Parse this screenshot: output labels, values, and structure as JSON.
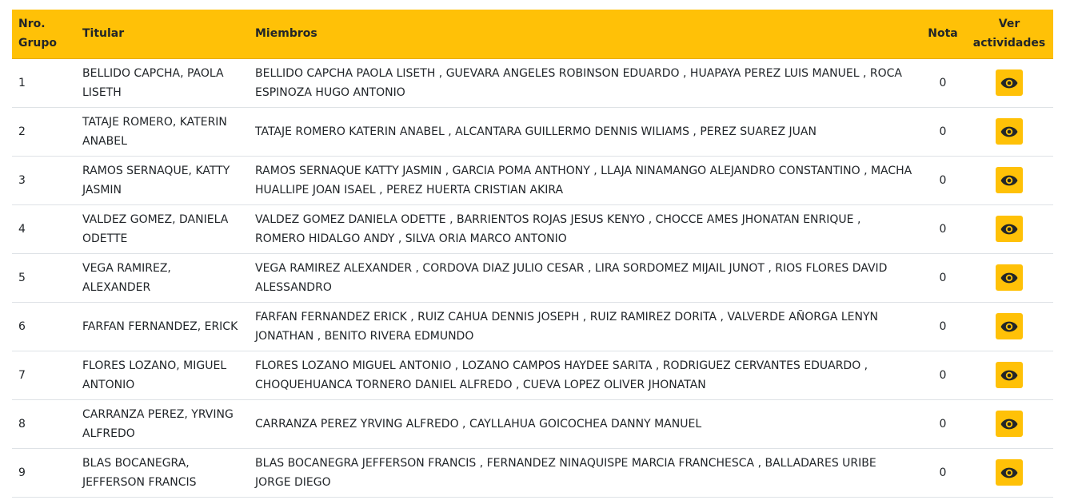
{
  "table": {
    "headers": {
      "nro": "Nro. Grupo",
      "titular": "Titular",
      "miembros": "Miembros",
      "nota": "Nota",
      "ver": "Ver actividades"
    },
    "rows": [
      {
        "nro": "1",
        "titular": "BELLIDO CAPCHA, PAOLA LISETH",
        "miembros": "BELLIDO CAPCHA PAOLA LISETH , GUEVARA ANGELES ROBINSON EDUARDO , HUAPAYA PEREZ LUIS MANUEL , ROCA ESPINOZA HUGO ANTONIO",
        "nota": "0"
      },
      {
        "nro": "2",
        "titular": "TATAJE ROMERO, KATERIN ANABEL",
        "miembros": "TATAJE ROMERO KATERIN ANABEL , ALCANTARA GUILLERMO DENNIS WILIAMS , PEREZ SUAREZ JUAN",
        "nota": "0"
      },
      {
        "nro": "3",
        "titular": "RAMOS SERNAQUE, KATTY JASMIN",
        "miembros": "RAMOS SERNAQUE KATTY JASMIN , GARCIA POMA ANTHONY , LLAJA NINAMANGO ALEJANDRO CONSTANTINO , MACHA HUALLIPE JOAN ISAEL , PEREZ HUERTA CRISTIAN AKIRA",
        "nota": "0"
      },
      {
        "nro": "4",
        "titular": "VALDEZ GOMEZ, DANIELA ODETTE",
        "miembros": "VALDEZ GOMEZ DANIELA ODETTE , BARRIENTOS ROJAS JESUS KENYO , CHOCCE AMES JHONATAN ENRIQUE , ROMERO HIDALGO ANDY , SILVA ORIA MARCO ANTONIO",
        "nota": "0"
      },
      {
        "nro": "5",
        "titular": "VEGA RAMIREZ, ALEXANDER",
        "miembros": "VEGA RAMIREZ ALEXANDER , CORDOVA DIAZ JULIO CESAR , LIRA SORDOMEZ MIJAIL JUNOT , RIOS FLORES DAVID ALESSANDRO",
        "nota": "0"
      },
      {
        "nro": "6",
        "titular": "FARFAN FERNANDEZ, ERICK",
        "miembros": "FARFAN FERNANDEZ ERICK , RUIZ CAHUA DENNIS JOSEPH , RUIZ RAMIREZ DORITA , VALVERDE AÑORGA LENYN JONATHAN , BENITO RIVERA EDMUNDO",
        "nota": "0"
      },
      {
        "nro": "7",
        "titular": "FLORES LOZANO, MIGUEL ANTONIO",
        "miembros": "FLORES LOZANO MIGUEL ANTONIO , LOZANO CAMPOS HAYDEE SARITA , RODRIGUEZ CERVANTES EDUARDO , CHOQUEHUANCA TORNERO DANIEL ALFREDO , CUEVA LOPEZ OLIVER JHONATAN",
        "nota": "0"
      },
      {
        "nro": "8",
        "titular": "CARRANZA PEREZ, YRVING ALFREDO",
        "miembros": "CARRANZA PEREZ YRVING ALFREDO , CAYLLAHUA GOICOCHEA DANNY MANUEL",
        "nota": "0"
      },
      {
        "nro": "9",
        "titular": "BLAS BOCANEGRA, JEFFERSON FRANCIS",
        "miembros": "BLAS BOCANEGRA JEFFERSON FRANCIS , FERNANDEZ NINAQUISPE MARCIA FRANCHESCA , BALLADARES URIBE JORGE DIEGO",
        "nota": "0"
      }
    ],
    "action_icon": "eye-icon",
    "colors": {
      "header_bg": "#ffc107",
      "button_bg": "#ffc107",
      "text": "#212529"
    }
  }
}
